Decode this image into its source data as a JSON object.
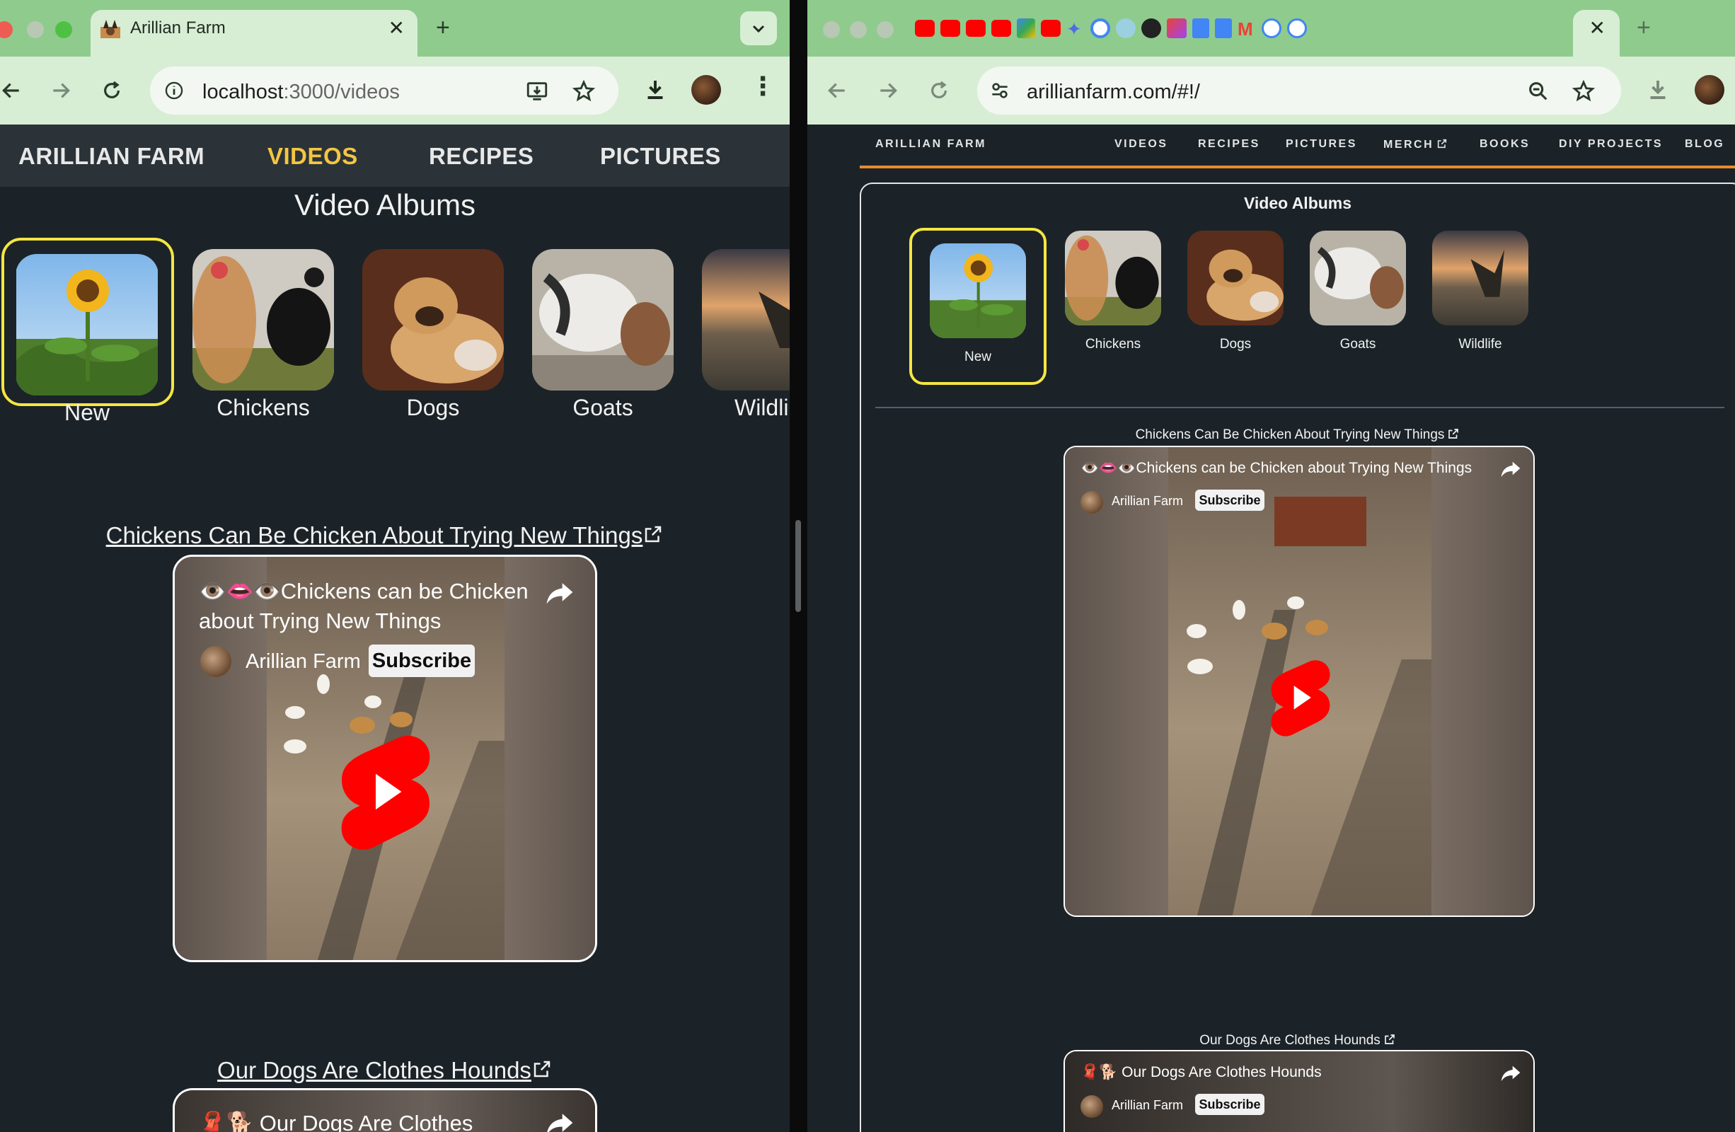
{
  "left": {
    "tab": {
      "title": "Arillian Farm"
    },
    "url": {
      "host": "localhost",
      "path": ":3000/videos"
    },
    "nav": [
      {
        "label": "ARILLIAN FARM",
        "active": false
      },
      {
        "label": "VIDEOS",
        "active": true
      },
      {
        "label": "RECIPES",
        "active": false
      },
      {
        "label": "PICTURES",
        "active": false
      }
    ],
    "section_title": "Video Albums",
    "albums": [
      "New",
      "Chickens",
      "Dogs",
      "Goats",
      "Wildli"
    ],
    "videos": [
      {
        "link": "Chickens Can Be Chicken About Trying New Things",
        "title_line1": "👁️👄👁️Chickens can be Chicken",
        "title_line2": "about Trying New Things",
        "channel": "Arillian Farm",
        "subscribe": "Subscribe"
      },
      {
        "link": "Our Dogs Are Clothes Hounds",
        "title_line1": "🧣🐕 Our Dogs Are Clothes",
        "channel": "Arillian Farm",
        "subscribe": "Subscribe"
      }
    ]
  },
  "right": {
    "url": {
      "text": "arillianfarm.com/#!/"
    },
    "nav": {
      "brand": "ARILLIAN FARM",
      "items": [
        "VIDEOS",
        "RECIPES",
        "PICTURES",
        "MERCH",
        "BOOKS",
        "DIY PROJECTS",
        "BLOG"
      ]
    },
    "section_title": "Video Albums",
    "albums": [
      "New",
      "Chickens",
      "Dogs",
      "Goats",
      "Wildlife"
    ],
    "videos": [
      {
        "link": "Chickens Can Be Chicken About Trying New Things",
        "title": "👁️👄👁️Chickens can be Chicken about Trying New Things",
        "channel": "Arillian Farm",
        "subscribe": "Subscribe"
      },
      {
        "link": "Our Dogs Are Clothes Hounds",
        "title": "🧣🐕 Our Dogs Are Clothes Hounds",
        "channel": "Arillian Farm",
        "subscribe": "Subscribe"
      }
    ]
  },
  "colors": {
    "accent_yellow": "#f5e642",
    "active_nav": "#f5c542",
    "orange": "#e98a2b",
    "page_bg": "#1b2328",
    "chrome_green": "#8fcb8d"
  }
}
